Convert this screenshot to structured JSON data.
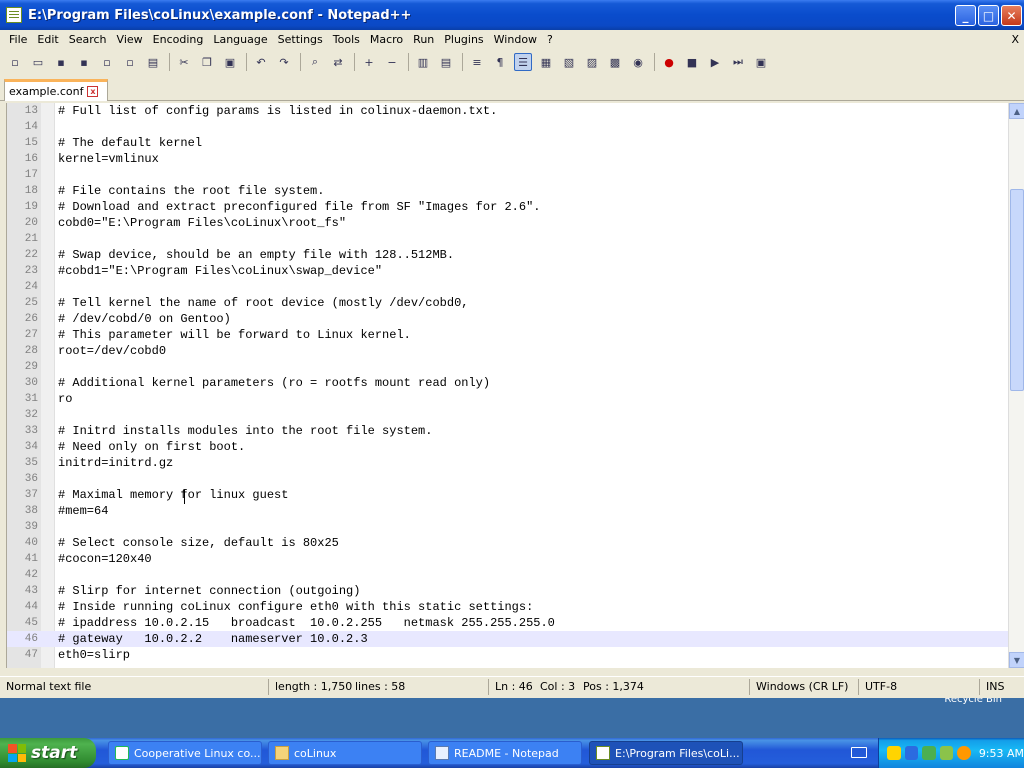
{
  "window": {
    "title": "E:\\Program Files\\coLinux\\example.conf - Notepad++"
  },
  "menu": [
    "File",
    "Edit",
    "Search",
    "View",
    "Encoding",
    "Language",
    "Settings",
    "Tools",
    "Macro",
    "Run",
    "Plugins",
    "Window",
    "?"
  ],
  "close_x": "X",
  "tab": {
    "label": "example.conf"
  },
  "editor": {
    "current_line": 46,
    "lines": [
      {
        "n": "13",
        "t": "# Full list of config params is listed in colinux-daemon.txt."
      },
      {
        "n": "14",
        "t": ""
      },
      {
        "n": "15",
        "t": "# The default kernel"
      },
      {
        "n": "16",
        "t": "kernel=vmlinux"
      },
      {
        "n": "17",
        "t": ""
      },
      {
        "n": "18",
        "t": "# File contains the root file system."
      },
      {
        "n": "19",
        "t": "# Download and extract preconfigured file from SF \"Images for 2.6\"."
      },
      {
        "n": "20",
        "t": "cobd0=\"E:\\Program Files\\coLinux\\root_fs\""
      },
      {
        "n": "21",
        "t": ""
      },
      {
        "n": "22",
        "t": "# Swap device, should be an empty file with 128..512MB."
      },
      {
        "n": "23",
        "t": "#cobd1=\"E:\\Program Files\\coLinux\\swap_device\""
      },
      {
        "n": "24",
        "t": ""
      },
      {
        "n": "25",
        "t": "# Tell kernel the name of root device (mostly /dev/cobd0,"
      },
      {
        "n": "26",
        "t": "# /dev/cobd/0 on Gentoo)"
      },
      {
        "n": "27",
        "t": "# This parameter will be forward to Linux kernel."
      },
      {
        "n": "28",
        "t": "root=/dev/cobd0"
      },
      {
        "n": "29",
        "t": ""
      },
      {
        "n": "30",
        "t": "# Additional kernel parameters (ro = rootfs mount read only)"
      },
      {
        "n": "31",
        "t": "ro"
      },
      {
        "n": "32",
        "t": ""
      },
      {
        "n": "33",
        "t": "# Initrd installs modules into the root file system."
      },
      {
        "n": "34",
        "t": "# Need only on first boot."
      },
      {
        "n": "35",
        "t": "initrd=initrd.gz"
      },
      {
        "n": "36",
        "t": ""
      },
      {
        "n": "37",
        "t": "# Maximal memory for linux guest"
      },
      {
        "n": "38",
        "t": "#mem=64"
      },
      {
        "n": "39",
        "t": ""
      },
      {
        "n": "40",
        "t": "# Select console size, default is 80x25"
      },
      {
        "n": "41",
        "t": "#cocon=120x40"
      },
      {
        "n": "42",
        "t": ""
      },
      {
        "n": "43",
        "t": "# Slirp for internet connection (outgoing)"
      },
      {
        "n": "44",
        "t": "# Inside running coLinux configure eth0 with this static settings:"
      },
      {
        "n": "45",
        "t": "# ipaddress 10.0.2.15   broadcast  10.0.2.255   netmask 255.255.255.0"
      },
      {
        "n": "46",
        "t": "# gateway   10.0.2.2    nameserver 10.0.2.3"
      },
      {
        "n": "47",
        "t": "eth0=slirp"
      }
    ]
  },
  "status": {
    "filetype": "Normal text file",
    "length": "length : 1,750",
    "lines": "lines : 58",
    "ln": "Ln : 46",
    "col": "Col : 3",
    "pos": "Pos : 1,374",
    "eol": "Windows (CR LF)",
    "encoding": "UTF-8",
    "mode": "INS"
  },
  "desktop": {
    "recycle_bin": "Recycle Bin"
  },
  "taskbar": {
    "start": "start",
    "tasks": [
      {
        "label": "Cooperative Linux co...",
        "icon": "ie-icon"
      },
      {
        "label": "coLinux",
        "icon": "folder-icon"
      },
      {
        "label": "README - Notepad",
        "icon": "notepad-icon"
      },
      {
        "label": "E:\\Program Files\\coLi...",
        "icon": "notepadpp-icon"
      }
    ],
    "clock": "9:53 AM"
  },
  "colors": {
    "titlebar": "#0a4ccc",
    "chrome": "#ece9d8",
    "current_line": "#e8e8ff",
    "taskbar": "#245edb"
  }
}
